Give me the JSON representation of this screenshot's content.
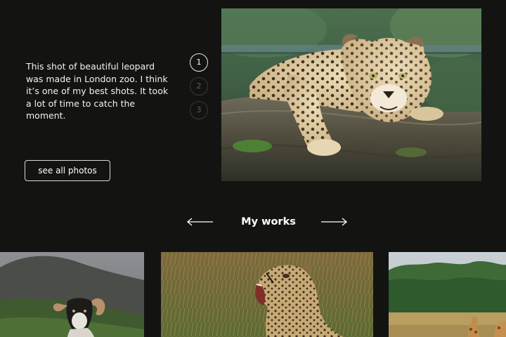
{
  "hero": {
    "description": "This shot of beautiful leopard was made in London zoo. I think it’s one of my best shots. It took a lot of time to catch the moment.",
    "button_label": "see all photos",
    "pager": [
      "1",
      "2",
      "3"
    ],
    "active_slide": 1,
    "photo_icon": "leopard-on-log-photo"
  },
  "works": {
    "title": "My works",
    "prev_icon": "arrow-left-icon",
    "next_icon": "arrow-right-icon",
    "items": [
      {
        "icon": "sheep-photo"
      },
      {
        "icon": "cheetah-photo"
      },
      {
        "icon": "giraffes-photo"
      }
    ]
  },
  "colors": {
    "background": "#131412",
    "text": "#ffffff",
    "muted": "#5e5f5d"
  }
}
